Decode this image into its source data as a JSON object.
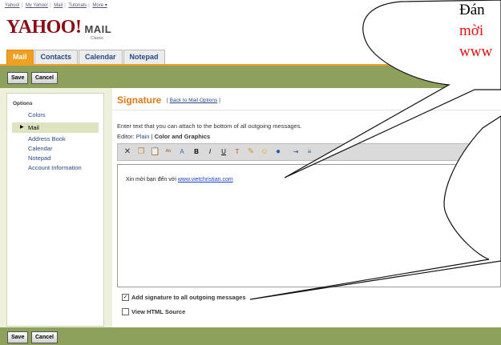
{
  "top_links": [
    "Yahoo!",
    "My Yahoo!",
    "Mail",
    "Tutorials",
    "More ▾"
  ],
  "brand": {
    "logo": "YAHOO!",
    "product": "MAIL",
    "edition": "Classic"
  },
  "tabs": [
    "Mail",
    "Contacts",
    "Calendar",
    "Notepad"
  ],
  "toolbar": {
    "save": "Save",
    "cancel": "Cancel"
  },
  "options": {
    "title": "Options",
    "items": [
      "Colors",
      "Mail",
      "Address Book",
      "Calendar",
      "Notepad",
      "Account Information"
    ]
  },
  "signature": {
    "title": "Signature",
    "back_link": "Back to Mail Options",
    "bracket_open": "[",
    "bracket_close": "]",
    "intro": "Enter text that you can attach to the bottom of all outgoing messages.",
    "editor_label": "Editor:",
    "editor_plain": "Plain",
    "editor_sep": "|",
    "editor_color": "Color and Graphics",
    "text_prefix": "Xin mời bạn đến với",
    "text_url": "www.vietchristian.com",
    "add_sig_label": "Add signature to all outgoing messages",
    "add_sig_checked": true,
    "view_html_label": "View HTML Source",
    "view_html_checked": false
  },
  "callout": {
    "line1": "Đán",
    "line2": "mời",
    "line3": "www"
  },
  "colors": {
    "orange": "#f0a020",
    "toolbar_green": "#8da15c",
    "brand_red": "#8b0e17",
    "callout_red": "#e01010"
  }
}
